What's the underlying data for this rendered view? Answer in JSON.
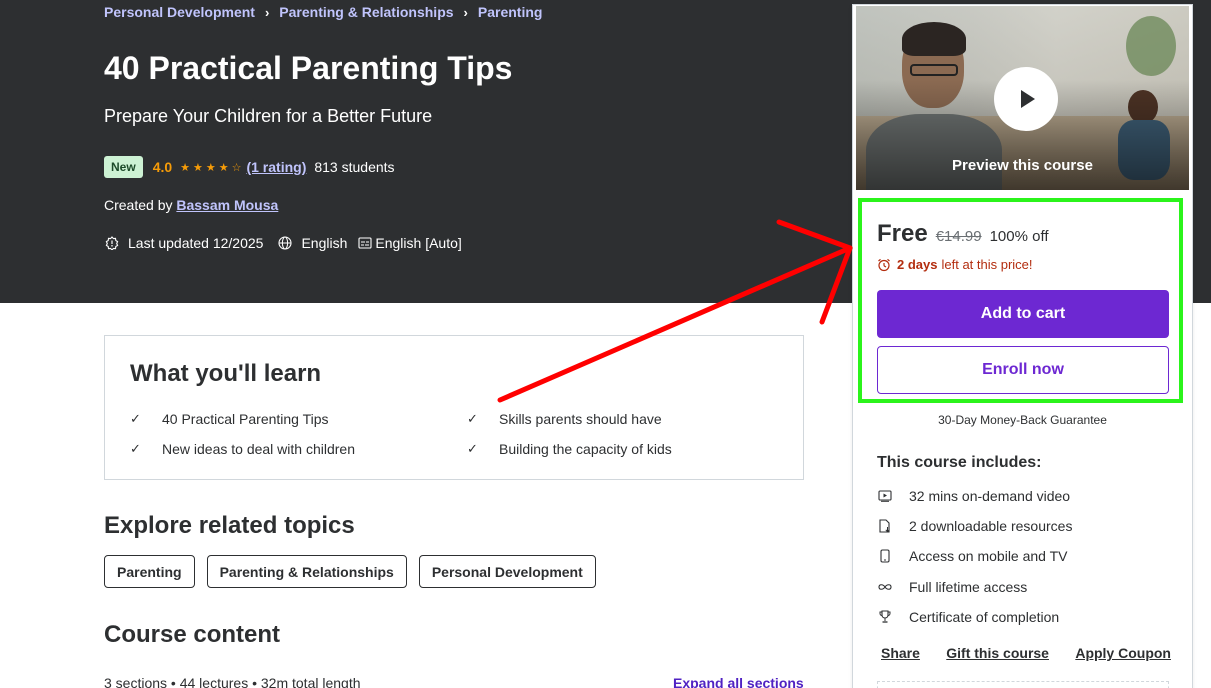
{
  "breadcrumb": [
    "Personal Development",
    "Parenting & Relationships",
    "Parenting"
  ],
  "course": {
    "title": "40 Practical Parenting Tips",
    "subtitle": "Prepare Your Children for a Better Future",
    "badge": "New",
    "rating": "4.0",
    "rating_count": "(1 rating)",
    "students": "813 students",
    "created_by_label": "Created by",
    "author": "Bassam Mousa",
    "last_updated": "Last updated 12/2025",
    "language": "English",
    "captions": "English [Auto]"
  },
  "learn": {
    "title": "What you'll learn",
    "items": [
      "40 Practical Parenting Tips",
      "Skills parents should have",
      "New ideas to deal with children",
      "Building the capacity of kids"
    ]
  },
  "topics": {
    "title": "Explore related topics",
    "items": [
      "Parenting",
      "Parenting & Relationships",
      "Personal Development"
    ]
  },
  "content": {
    "title": "Course content",
    "meta": "3 sections • 44 lectures • 32m total length",
    "expand": "Expand all sections"
  },
  "sidebar": {
    "preview_label": "Preview this course",
    "price": "Free",
    "original_price": "€14.99",
    "discount": "100% off",
    "days_bold": "2 days",
    "days_rest": "left at this price!",
    "add_to_cart": "Add to cart",
    "enroll": "Enroll now",
    "guarantee": "30-Day Money-Back Guarantee",
    "includes_title": "This course includes:",
    "includes": [
      "32 mins on-demand video",
      "2 downloadable resources",
      "Access on mobile and TV",
      "Full lifetime access",
      "Certificate of completion"
    ],
    "links": [
      "Share",
      "Gift this course",
      "Apply Coupon"
    ]
  },
  "colors": {
    "hero_bg": "#2d2f31",
    "accent_purple": "#6d28d2",
    "link_lavender": "#c0c4fc",
    "star": "#f69c08",
    "urgency_red": "#b32d0f",
    "highlight_green": "#2bf41b",
    "arrow_red": "#ff0000"
  }
}
